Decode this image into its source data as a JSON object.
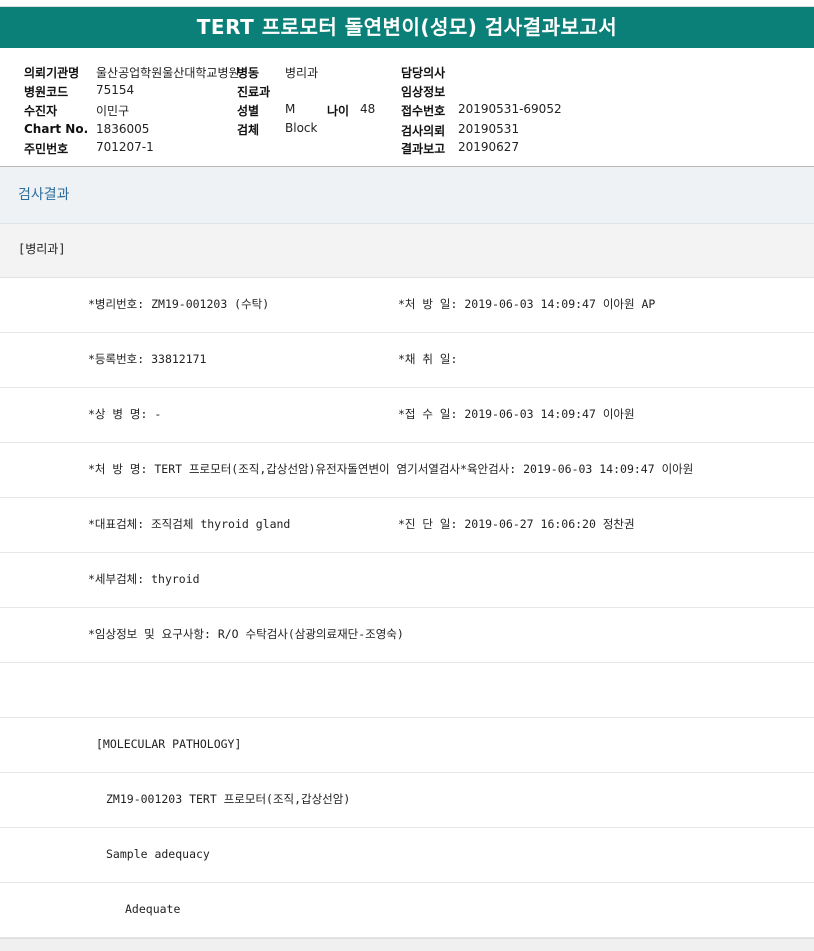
{
  "report": {
    "title": "TERT 프로모터 돌연변이(성모) 검사결과보고서"
  },
  "patient_info": {
    "institution_label": "의뢰기관명",
    "institution_value": "울산공업학원울산대학교병원",
    "ward_label": "병동",
    "ward_value": "병리과",
    "doctor_label": "담당의사",
    "doctor_value": "",
    "hospital_code_label": "병원코드",
    "hospital_code_value": "75154",
    "dept_label": "진료과",
    "dept_value": "",
    "clinical_label": "임상정보",
    "clinical_value": "",
    "name_label": "수진자",
    "name_value": "이민구",
    "sex_label": "성별",
    "sex_value": "M",
    "age_label": "나이",
    "age_value": "48",
    "receipt_no_label": "접수번호",
    "receipt_no_value": "20190531-69052",
    "chart_label": "Chart No.",
    "chart_value": "1836005",
    "specimen_label": "검체",
    "specimen_value": "Block",
    "request_label": "검사의뢰",
    "request_value": "20190531",
    "resident_label": "주민번호",
    "resident_value": "701207-1",
    "report_label": "결과보고",
    "report_value": "20190627"
  },
  "results": {
    "section_title": "검사결과",
    "department": "[병리과]",
    "rows": [
      {
        "left": "*병리번호: ZM19-001203 (수탁)",
        "right": "*처 방 일: 2019-06-03 14:09:47  이아원 AP"
      },
      {
        "left": "*등록번호: 33812171",
        "right": "*채 취 일:"
      },
      {
        "left": "*상 병 명: -",
        "right": "*접 수 일: 2019-06-03 14:09:47  이아원"
      },
      {
        "left": "*처 방 명: TERT 프로모터(조직,갑상선암)유전자돌연변이 염기서열검사*육안검사: 2019-06-03 14:09:47  이아원",
        "right": ""
      },
      {
        "left": "*대표검체: 조직검체 thyroid gland",
        "right": "*진 단 일: 2019-06-27 16:06:20  정찬권"
      },
      {
        "left": "*세부검체: thyroid",
        "right": ""
      },
      {
        "left": "*임상정보 및 요구사항: R/O 수탁검사(삼광의료재단-조영숙)",
        "right": ""
      },
      {
        "left": "",
        "right": ""
      }
    ],
    "molecular_header": "[MOLECULAR PATHOLOGY]",
    "case_line": "ZM19-001203     TERT 프로모터(조직,갑상선암)",
    "adequacy_label": "Sample adequacy",
    "adequacy_value": "Adequate"
  }
}
